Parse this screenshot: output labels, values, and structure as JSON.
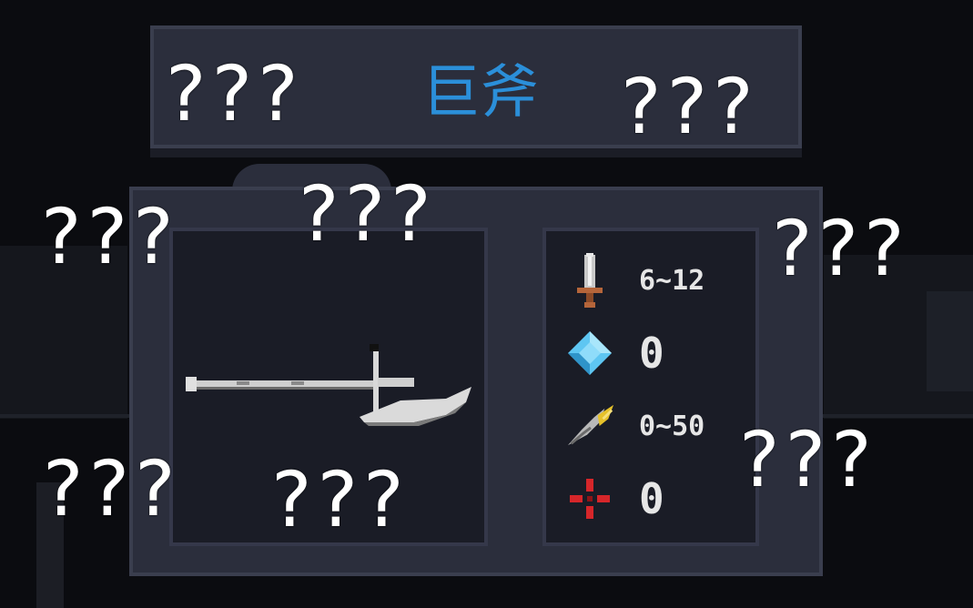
{
  "weapon": {
    "name": "巨斧",
    "name_color": "#2b8fd9"
  },
  "stats": [
    {
      "icon": "sword-icon",
      "value": "6~12"
    },
    {
      "icon": "diamond-icon",
      "value": "0"
    },
    {
      "icon": "feather-icon",
      "value": "0~50"
    },
    {
      "icon": "crosshair-icon",
      "value": "0"
    }
  ],
  "overlay": {
    "q1": "???",
    "q2": "???",
    "q3": "???",
    "q4": "???",
    "q5": "???",
    "q6": "???",
    "q7": "???",
    "q8": "???"
  }
}
